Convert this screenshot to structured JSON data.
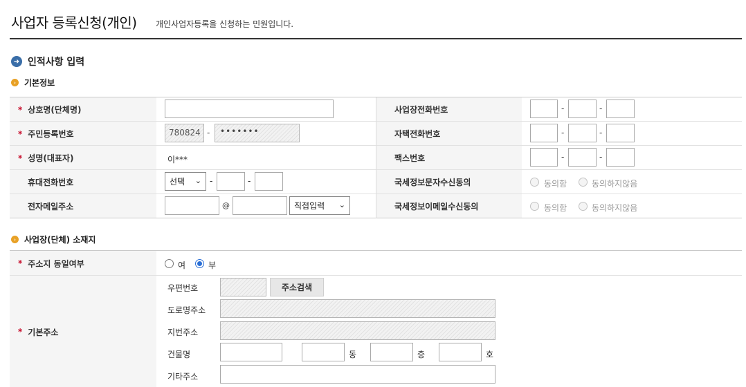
{
  "header": {
    "title": "사업자 등록신청(개인)",
    "description": "개인사업자등록을 신청하는 민원입니다."
  },
  "sections": {
    "personal": "인적사항 입력",
    "basic": "기본정보",
    "location": "사업장(단체) 소재지"
  },
  "basic_info": {
    "trade_name_label": "상호명(단체명)",
    "resident_no_label": "주민등록번호",
    "resident_no_front": "780824",
    "resident_no_back": "•••••••",
    "name_label": "성명(대표자)",
    "name_value": "이***",
    "mobile_label": "휴대전화번호",
    "mobile_select": "선택",
    "email_label": "전자메일주소",
    "email_at": "@",
    "email_domain_select": "직접입력",
    "biz_phone_label": "사업장전화번호",
    "home_phone_label": "자택전화번호",
    "fax_label": "팩스번호",
    "sms_consent_label": "국세정보문자수신동의",
    "email_consent_label": "국세정보이메일수신동의",
    "agree": "동의함",
    "disagree": "동의하지않음",
    "dash": "-"
  },
  "location": {
    "same_address_label": "주소지 동일여부",
    "yes": "여",
    "no": "부",
    "selected": "부",
    "basic_address_label": "기본주소",
    "postal_code_label": "우편번호",
    "address_search_button": "주소검색",
    "road_address_label": "도로명주소",
    "lot_address_label": "지번주소",
    "building_label": "건물명",
    "dong_unit": "동",
    "floor_unit": "층",
    "ho_unit": "호",
    "other_address_label": "기타주소"
  },
  "colors": {
    "required_star": "#c8102e",
    "section_icon_blue": "#3a6ea8",
    "sub_icon_orange": "#e8a126",
    "radio_selected": "#2a6fd6"
  },
  "icons": {
    "section": "arrow-circle-icon",
    "subsection": "orange-bullet-icon"
  }
}
